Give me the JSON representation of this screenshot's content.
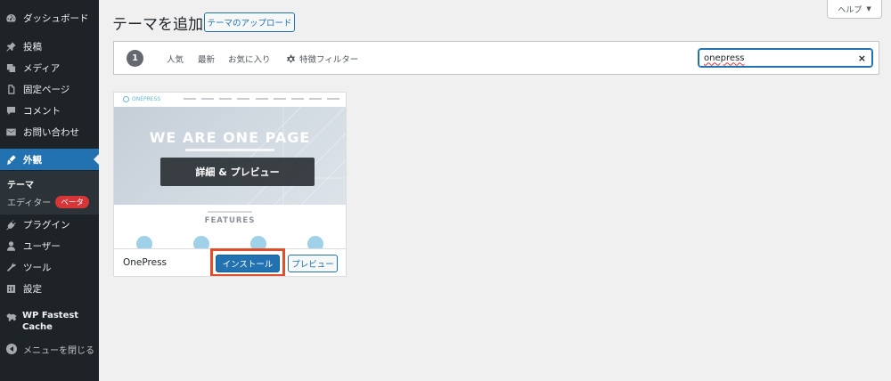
{
  "sidebar": {
    "items": [
      {
        "label": "ダッシュボード",
        "icon": "dashboard-icon"
      },
      {
        "label": "投稿",
        "icon": "pin-icon"
      },
      {
        "label": "メディア",
        "icon": "media-icon"
      },
      {
        "label": "固定ページ",
        "icon": "page-icon"
      },
      {
        "label": "コメント",
        "icon": "comment-icon"
      },
      {
        "label": "お問い合わせ",
        "icon": "mail-icon"
      },
      {
        "label": "外観",
        "icon": "brush-icon"
      },
      {
        "label": "プラグイン",
        "icon": "plugin-icon"
      },
      {
        "label": "ユーザー",
        "icon": "user-icon"
      },
      {
        "label": "ツール",
        "icon": "wrench-icon"
      },
      {
        "label": "設定",
        "icon": "settings-icon"
      }
    ],
    "submenu": {
      "themes": "テーマ",
      "editor": "エディター",
      "beta": "ベータ"
    },
    "wpfc_line1": "WP Fastest",
    "wpfc_line2": "Cache",
    "collapse": "メニューを閉じる"
  },
  "header": {
    "title": "テーマを追加",
    "upload_label": "テーマのアップロード",
    "help_label": "ヘルプ",
    "help_caret": "▼"
  },
  "filter": {
    "count": "1",
    "tabs": [
      "人気",
      "最新",
      "お気に入り"
    ],
    "feature_filter": "特徴フィルター",
    "search_value": "onepress",
    "clear": "×"
  },
  "theme_card": {
    "screenshot": {
      "logo": "ONEPRESS",
      "hero_title": "WE ARE ONE PAGE",
      "features_title": "FEATURES"
    },
    "overlay_label": "詳細 & プレビュー",
    "name": "OnePress",
    "install_label": "インストール",
    "preview_label": "プレビュー"
  },
  "colors": {
    "sidebar_bg": "#1d2327",
    "accent": "#2271b1",
    "highlight": "#e04e2b",
    "beta_badge": "#d63638"
  }
}
